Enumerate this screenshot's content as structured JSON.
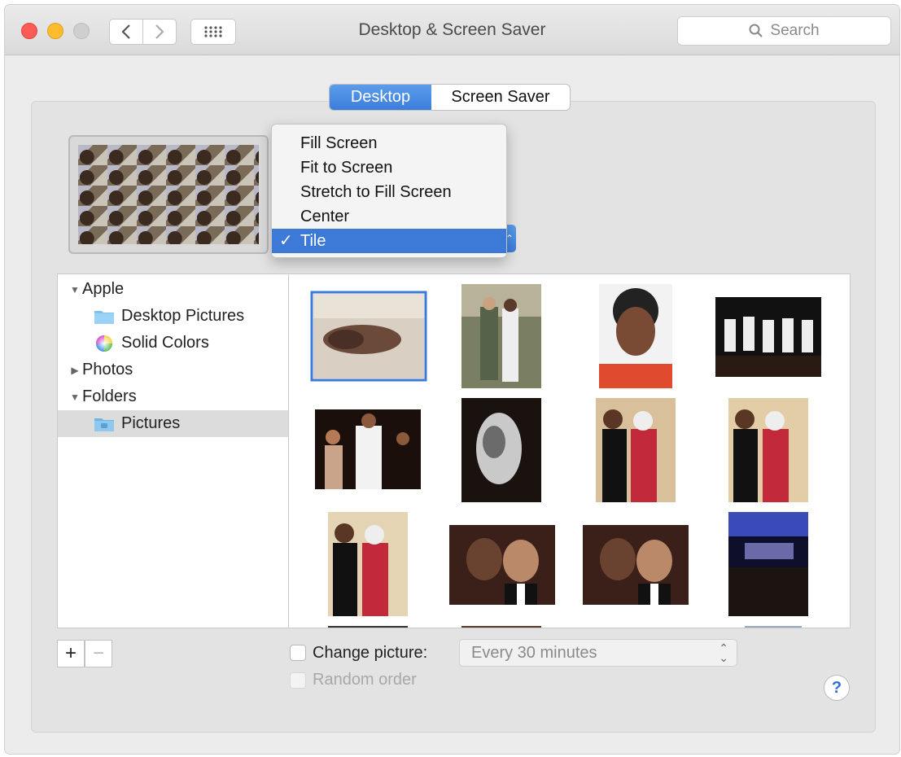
{
  "window": {
    "title": "Desktop & Screen Saver"
  },
  "toolbar": {
    "search_placeholder": "Search"
  },
  "tabs": [
    {
      "label": "Desktop",
      "active": true
    },
    {
      "label": "Screen Saver",
      "active": false
    }
  ],
  "fit_menu": {
    "items": [
      "Fill Screen",
      "Fit to Screen",
      "Stretch to Fill Screen",
      "Center",
      "Tile"
    ],
    "selected": "Tile",
    "check": "✓"
  },
  "sidebar": {
    "apple": "Apple",
    "desktop_pictures": "Desktop Pictures",
    "solid_colors": "Solid Colors",
    "photos": "Photos",
    "folders": "Folders",
    "pictures": "Pictures"
  },
  "bottom": {
    "change_picture_label": "Change picture:",
    "interval": "Every 30 minutes",
    "random_order": "Random order",
    "help": "?"
  },
  "colors": {
    "accent": "#3d79d6",
    "close": "#fc5c55",
    "minimize": "#fdbc2e"
  }
}
